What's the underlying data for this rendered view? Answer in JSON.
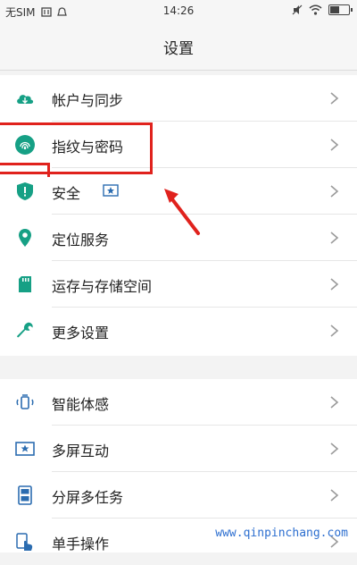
{
  "status_bar": {
    "carrier": "无SIM",
    "time": "14:26",
    "battery_level": 0.6
  },
  "header": {
    "title": "设置"
  },
  "group1": [
    {
      "label": "帐户与同步",
      "icon": "cloud-icon",
      "color": "#16a085"
    },
    {
      "label": "指纹与密码",
      "icon": "fingerprint-icon",
      "color": "#16a085"
    },
    {
      "label": "安全",
      "icon": "shield-icon",
      "color": "#16a085"
    },
    {
      "label": "定位服务",
      "icon": "location-pin-icon",
      "color": "#16a085"
    },
    {
      "label": "运存与存储空间",
      "icon": "sd-card-icon",
      "color": "#16a085"
    },
    {
      "label": "更多设置",
      "icon": "wrench-icon",
      "color": "#16a085"
    }
  ],
  "group2": [
    {
      "label": "智能体感",
      "icon": "motion-icon",
      "color": "#2b6cb0"
    },
    {
      "label": "多屏互动",
      "icon": "multiscreen-icon",
      "color": "#2b6cb0"
    },
    {
      "label": "分屏多任务",
      "icon": "split-screen-icon",
      "color": "#2b6cb0"
    },
    {
      "label": "单手操作",
      "icon": "one-hand-icon",
      "color": "#2b6cb0"
    }
  ],
  "watermark": "www.qinpinchang.com",
  "colors": {
    "accent": "#16a085",
    "annotation": "#e0221d"
  }
}
